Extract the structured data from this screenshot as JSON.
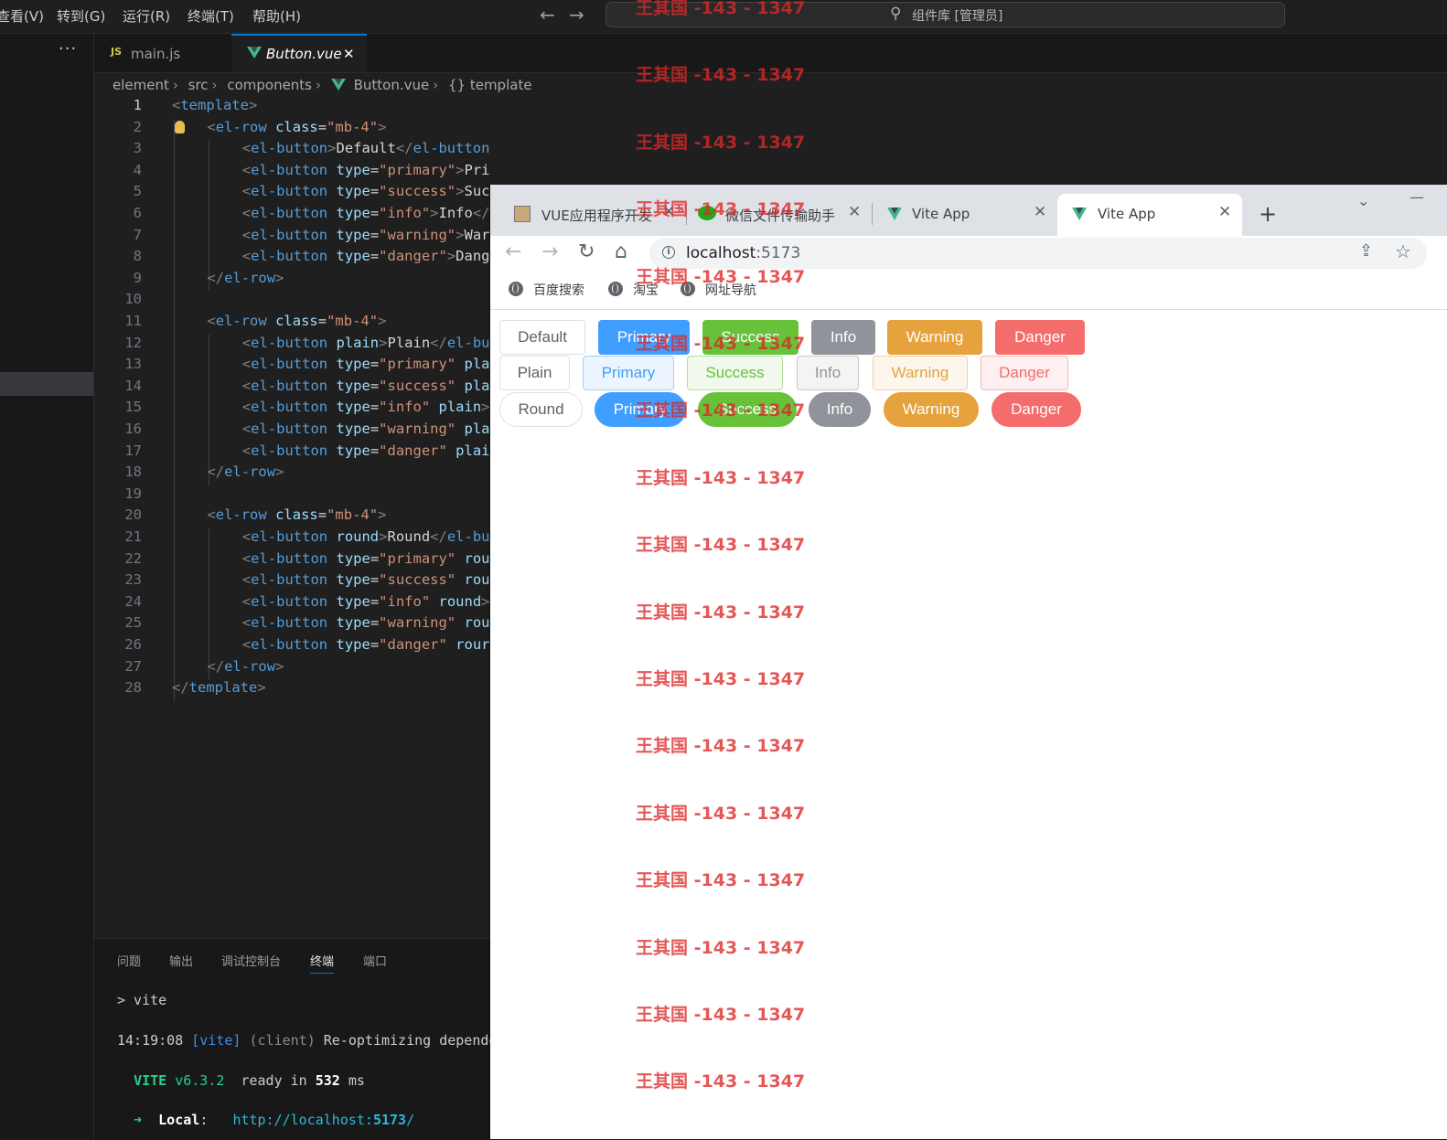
{
  "menu": [
    "查看(V)",
    "转到(G)",
    "运行(R)",
    "终端(T)",
    "帮助(H)"
  ],
  "command_center": "组件库 [管理员]",
  "editor_tabs": [
    {
      "icon": "js-icon",
      "icon_text": "JS",
      "label": "main.js",
      "active": false
    },
    {
      "icon": "vue-icon",
      "label": "Button.vue",
      "active": true,
      "close": "✕"
    }
  ],
  "breadcrumb": [
    "element",
    "src",
    "components",
    "Button.vue",
    "{} template"
  ],
  "code_lines": [
    {
      "n": "1",
      "i": 0,
      "parts": [
        [
          "tagb",
          "<"
        ],
        [
          "tag",
          "template"
        ],
        [
          "tagb",
          ">"
        ]
      ]
    },
    {
      "n": "2",
      "i": 1,
      "parts": [
        [
          "tagb",
          "<"
        ],
        [
          "tag",
          "el-row"
        ],
        [
          "txt",
          " "
        ],
        [
          "attr",
          "class"
        ],
        [
          "txt",
          "="
        ],
        [
          "str",
          "\"mb-4\""
        ],
        [
          "tagb",
          ">"
        ]
      ]
    },
    {
      "n": "3",
      "i": 2,
      "parts": [
        [
          "tagb",
          "<"
        ],
        [
          "tag",
          "el-button"
        ],
        [
          "tagb",
          ">"
        ],
        [
          "txt",
          "Default"
        ],
        [
          "tagb",
          "</"
        ],
        [
          "tag",
          "el-button"
        ],
        [
          "tagb",
          ">"
        ]
      ]
    },
    {
      "n": "4",
      "i": 2,
      "parts": [
        [
          "tagb",
          "<"
        ],
        [
          "tag",
          "el-button"
        ],
        [
          "txt",
          " "
        ],
        [
          "attr",
          "type"
        ],
        [
          "txt",
          "="
        ],
        [
          "str",
          "\"primary\""
        ],
        [
          "tagb",
          ">"
        ],
        [
          "txt",
          "Primary"
        ],
        [
          "tagb",
          "</"
        ],
        [
          "tag",
          "el-button"
        ],
        [
          "tagb",
          ">"
        ]
      ]
    },
    {
      "n": "5",
      "i": 2,
      "parts": [
        [
          "tagb",
          "<"
        ],
        [
          "tag",
          "el-button"
        ],
        [
          "txt",
          " "
        ],
        [
          "attr",
          "type"
        ],
        [
          "txt",
          "="
        ],
        [
          "str",
          "\"success\""
        ],
        [
          "tagb",
          ">"
        ],
        [
          "txt",
          "Suc"
        ]
      ]
    },
    {
      "n": "6",
      "i": 2,
      "parts": [
        [
          "tagb",
          "<"
        ],
        [
          "tag",
          "el-button"
        ],
        [
          "txt",
          " "
        ],
        [
          "attr",
          "type"
        ],
        [
          "txt",
          "="
        ],
        [
          "str",
          "\"info\""
        ],
        [
          "tagb",
          ">"
        ],
        [
          "txt",
          "Info"
        ],
        [
          "tagb",
          "</"
        ]
      ]
    },
    {
      "n": "7",
      "i": 2,
      "parts": [
        [
          "tagb",
          "<"
        ],
        [
          "tag",
          "el-button"
        ],
        [
          "txt",
          " "
        ],
        [
          "attr",
          "type"
        ],
        [
          "txt",
          "="
        ],
        [
          "str",
          "\"warning\""
        ],
        [
          "tagb",
          ">"
        ],
        [
          "txt",
          "War"
        ]
      ]
    },
    {
      "n": "8",
      "i": 2,
      "parts": [
        [
          "tagb",
          "<"
        ],
        [
          "tag",
          "el-button"
        ],
        [
          "txt",
          " "
        ],
        [
          "attr",
          "type"
        ],
        [
          "txt",
          "="
        ],
        [
          "str",
          "\"danger\""
        ],
        [
          "tagb",
          ">"
        ],
        [
          "txt",
          "Dang"
        ]
      ]
    },
    {
      "n": "9",
      "i": 1,
      "parts": [
        [
          "tagb",
          "</"
        ],
        [
          "tag",
          "el-row"
        ],
        [
          "tagb",
          ">"
        ]
      ]
    },
    {
      "n": "10",
      "i": 0,
      "parts": []
    },
    {
      "n": "11",
      "i": 1,
      "parts": [
        [
          "tagb",
          "<"
        ],
        [
          "tag",
          "el-row"
        ],
        [
          "txt",
          " "
        ],
        [
          "attr",
          "class"
        ],
        [
          "txt",
          "="
        ],
        [
          "str",
          "\"mb-4\""
        ],
        [
          "tagb",
          ">"
        ]
      ]
    },
    {
      "n": "12",
      "i": 2,
      "parts": [
        [
          "tagb",
          "<"
        ],
        [
          "tag",
          "el-button"
        ],
        [
          "txt",
          " "
        ],
        [
          "attr",
          "plain"
        ],
        [
          "tagb",
          ">"
        ],
        [
          "txt",
          "Plain"
        ],
        [
          "tagb",
          "</"
        ],
        [
          "tag",
          "el-bu"
        ]
      ]
    },
    {
      "n": "13",
      "i": 2,
      "parts": [
        [
          "tagb",
          "<"
        ],
        [
          "tag",
          "el-button"
        ],
        [
          "txt",
          " "
        ],
        [
          "attr",
          "type"
        ],
        [
          "txt",
          "="
        ],
        [
          "str",
          "\"primary\""
        ],
        [
          "txt",
          " "
        ],
        [
          "attr",
          "pla"
        ]
      ]
    },
    {
      "n": "14",
      "i": 2,
      "parts": [
        [
          "tagb",
          "<"
        ],
        [
          "tag",
          "el-button"
        ],
        [
          "txt",
          " "
        ],
        [
          "attr",
          "type"
        ],
        [
          "txt",
          "="
        ],
        [
          "str",
          "\"success\""
        ],
        [
          "txt",
          " "
        ],
        [
          "attr",
          "pla"
        ]
      ]
    },
    {
      "n": "15",
      "i": 2,
      "parts": [
        [
          "tagb",
          "<"
        ],
        [
          "tag",
          "el-button"
        ],
        [
          "txt",
          " "
        ],
        [
          "attr",
          "type"
        ],
        [
          "txt",
          "="
        ],
        [
          "str",
          "\"info\""
        ],
        [
          "txt",
          " "
        ],
        [
          "attr",
          "plain"
        ],
        [
          "tagb",
          ">"
        ]
      ]
    },
    {
      "n": "16",
      "i": 2,
      "parts": [
        [
          "tagb",
          "<"
        ],
        [
          "tag",
          "el-button"
        ],
        [
          "txt",
          " "
        ],
        [
          "attr",
          "type"
        ],
        [
          "txt",
          "="
        ],
        [
          "str",
          "\"warning\""
        ],
        [
          "txt",
          " "
        ],
        [
          "attr",
          "pla"
        ]
      ]
    },
    {
      "n": "17",
      "i": 2,
      "parts": [
        [
          "tagb",
          "<"
        ],
        [
          "tag",
          "el-button"
        ],
        [
          "txt",
          " "
        ],
        [
          "attr",
          "type"
        ],
        [
          "txt",
          "="
        ],
        [
          "str",
          "\"danger\""
        ],
        [
          "txt",
          " "
        ],
        [
          "attr",
          "plai"
        ]
      ]
    },
    {
      "n": "18",
      "i": 1,
      "parts": [
        [
          "tagb",
          "</"
        ],
        [
          "tag",
          "el-row"
        ],
        [
          "tagb",
          ">"
        ]
      ]
    },
    {
      "n": "19",
      "i": 0,
      "parts": []
    },
    {
      "n": "20",
      "i": 1,
      "parts": [
        [
          "tagb",
          "<"
        ],
        [
          "tag",
          "el-row"
        ],
        [
          "txt",
          " "
        ],
        [
          "attr",
          "class"
        ],
        [
          "txt",
          "="
        ],
        [
          "str",
          "\"mb-4\""
        ],
        [
          "tagb",
          ">"
        ]
      ]
    },
    {
      "n": "21",
      "i": 2,
      "parts": [
        [
          "tagb",
          "<"
        ],
        [
          "tag",
          "el-button"
        ],
        [
          "txt",
          " "
        ],
        [
          "attr",
          "round"
        ],
        [
          "tagb",
          ">"
        ],
        [
          "txt",
          "Round"
        ],
        [
          "tagb",
          "</"
        ],
        [
          "tag",
          "el-bu"
        ]
      ]
    },
    {
      "n": "22",
      "i": 2,
      "parts": [
        [
          "tagb",
          "<"
        ],
        [
          "tag",
          "el-button"
        ],
        [
          "txt",
          " "
        ],
        [
          "attr",
          "type"
        ],
        [
          "txt",
          "="
        ],
        [
          "str",
          "\"primary\""
        ],
        [
          "txt",
          " "
        ],
        [
          "attr",
          "rou"
        ]
      ]
    },
    {
      "n": "23",
      "i": 2,
      "parts": [
        [
          "tagb",
          "<"
        ],
        [
          "tag",
          "el-button"
        ],
        [
          "txt",
          " "
        ],
        [
          "attr",
          "type"
        ],
        [
          "txt",
          "="
        ],
        [
          "str",
          "\"success\""
        ],
        [
          "txt",
          " "
        ],
        [
          "attr",
          "rou"
        ]
      ]
    },
    {
      "n": "24",
      "i": 2,
      "parts": [
        [
          "tagb",
          "<"
        ],
        [
          "tag",
          "el-button"
        ],
        [
          "txt",
          " "
        ],
        [
          "attr",
          "type"
        ],
        [
          "txt",
          "="
        ],
        [
          "str",
          "\"info\""
        ],
        [
          "txt",
          " "
        ],
        [
          "attr",
          "round"
        ],
        [
          "tagb",
          ">"
        ]
      ]
    },
    {
      "n": "25",
      "i": 2,
      "parts": [
        [
          "tagb",
          "<"
        ],
        [
          "tag",
          "el-button"
        ],
        [
          "txt",
          " "
        ],
        [
          "attr",
          "type"
        ],
        [
          "txt",
          "="
        ],
        [
          "str",
          "\"warning\""
        ],
        [
          "txt",
          " "
        ],
        [
          "attr",
          "rou"
        ]
      ]
    },
    {
      "n": "26",
      "i": 2,
      "parts": [
        [
          "tagb",
          "<"
        ],
        [
          "tag",
          "el-button"
        ],
        [
          "txt",
          " "
        ],
        [
          "attr",
          "type"
        ],
        [
          "txt",
          "="
        ],
        [
          "str",
          "\"danger\""
        ],
        [
          "txt",
          " "
        ],
        [
          "attr",
          "rour"
        ]
      ]
    },
    {
      "n": "27",
      "i": 1,
      "parts": [
        [
          "tagb",
          "</"
        ],
        [
          "tag",
          "el-row"
        ],
        [
          "tagb",
          ">"
        ]
      ]
    },
    {
      "n": "28",
      "i": 0,
      "parts": [
        [
          "tagb",
          "</"
        ],
        [
          "tag",
          "template"
        ],
        [
          "tagb",
          ">"
        ]
      ]
    }
  ],
  "panel": {
    "tabs": [
      "问题",
      "输出",
      "调试控制台",
      "终端",
      "端口"
    ],
    "active_tab": "终端",
    "terminal": [
      [
        [
          "#cccccc",
          "> vite"
        ]
      ],
      [
        [
          "#cccccc",
          "14:19:08 "
        ],
        [
          "#3b8eea",
          "[vite]"
        ],
        [
          "#8a8a8a",
          " (client)"
        ],
        [
          "#cccccc",
          " Re-optimizing depende"
        ]
      ],
      [
        [
          "#cccccc",
          "  "
        ],
        [
          "#23d18b",
          "VITE"
        ],
        [
          "#23d18b",
          " v6.3.2"
        ],
        [
          "#cccccc",
          "  ready in "
        ],
        [
          "#ffffff",
          "532"
        ],
        [
          "#cccccc",
          " ms"
        ]
      ],
      [
        [
          "#23d18b",
          "  ➜  "
        ],
        [
          "#ffffff",
          "Local"
        ],
        [
          "#cccccc",
          ":   "
        ],
        [
          "#29b8db",
          "http://localhost:"
        ],
        [
          "#29b8db",
          "5173"
        ],
        [
          "#29b8db",
          "/"
        ]
      ]
    ]
  },
  "browser": {
    "tabs": [
      {
        "favicon": "dev-icon",
        "title": "VUE应用程序开发",
        "active": false
      },
      {
        "favicon": "wechat-icon",
        "title": "微信文件传输助手",
        "active": false
      },
      {
        "favicon": "vue-icon",
        "title": "Vite App",
        "active": false
      },
      {
        "favicon": "vue-icon",
        "title": "Vite App",
        "active": true
      }
    ],
    "new_tab": "+",
    "url_host": "localhost",
    "url_port": ":5173",
    "bookmarks": [
      "百度搜索",
      "淘宝",
      "网址导航"
    ],
    "button_rows": [
      [
        {
          "label": "Default",
          "type": "default"
        },
        {
          "label": "Primary",
          "type": "primary"
        },
        {
          "label": "Success",
          "type": "success"
        },
        {
          "label": "Info",
          "type": "info"
        },
        {
          "label": "Warning",
          "type": "warning"
        },
        {
          "label": "Danger",
          "type": "danger"
        }
      ],
      [
        {
          "label": "Plain",
          "type": "default plain"
        },
        {
          "label": "Primary",
          "type": "primary plain"
        },
        {
          "label": "Success",
          "type": "success plain"
        },
        {
          "label": "Info",
          "type": "info plain"
        },
        {
          "label": "Warning",
          "type": "warning plain"
        },
        {
          "label": "Danger",
          "type": "danger plain"
        }
      ],
      [
        {
          "label": "Round",
          "type": "default round"
        },
        {
          "label": "Primary",
          "type": "primary round"
        },
        {
          "label": "Success",
          "type": "success round"
        },
        {
          "label": "Info",
          "type": "info round"
        },
        {
          "label": "Warning",
          "type": "warning round"
        },
        {
          "label": "Danger",
          "type": "danger round"
        }
      ]
    ]
  },
  "watermark": "王其国 -143 - 1347",
  "colors": {
    "vscode_bg": "#1f1f1f",
    "accent": "#0078d4",
    "el_primary": "#409eff",
    "el_success": "#67c23a",
    "el_info": "#909399",
    "el_warning": "#e6a23c",
    "el_danger": "#f56c6c"
  }
}
